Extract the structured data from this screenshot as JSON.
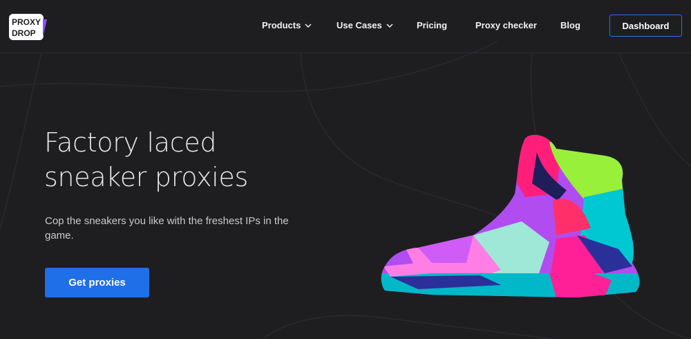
{
  "logo": {
    "line1": "PROXY",
    "line2": "DROP"
  },
  "nav": {
    "products": "Products",
    "use_cases": "Use Cases",
    "pricing": "Pricing",
    "proxy_checker": "Proxy checker",
    "blog": "Blog",
    "dashboard": "Dashboard"
  },
  "hero": {
    "title": "Factory laced sneaker proxies",
    "subtitle": "Cop the sneakers you like with the freshest IPs in the game.",
    "cta": "Get proxies"
  },
  "colors": {
    "background": "#1e1e21",
    "accent": "#1f6fe8",
    "logo_accent": "#8a4fff"
  },
  "icons": [
    "chevron-down-icon",
    "sneaker-illustration"
  ]
}
